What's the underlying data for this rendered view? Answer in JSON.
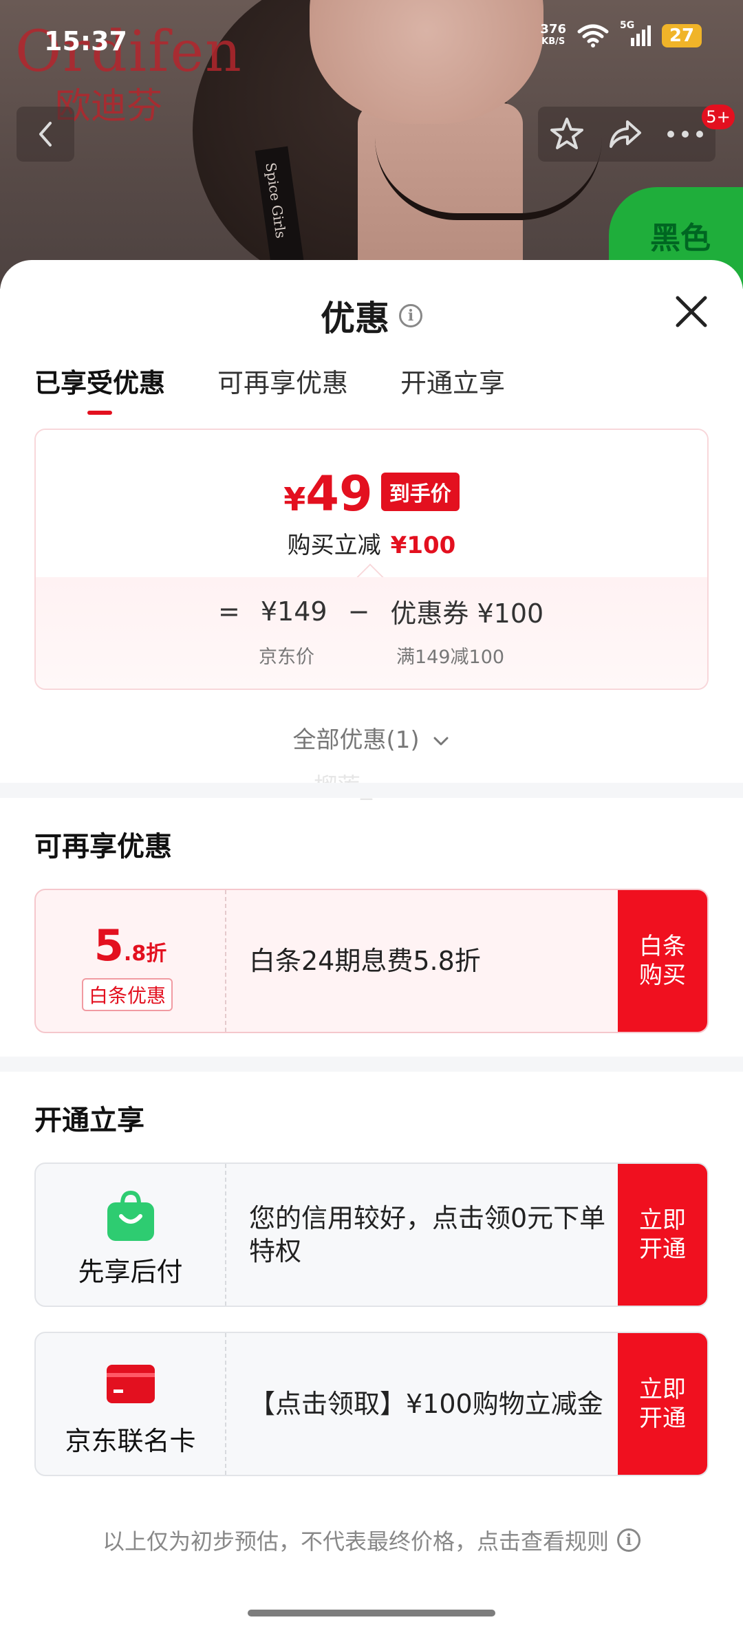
{
  "status_bar": {
    "time": "15:37",
    "net_speed_value": "376",
    "net_speed_unit": "KB/S",
    "network_type": "5G",
    "battery": "27"
  },
  "product_bg": {
    "brand_latin": "Ordifen",
    "brand_cn": "欧迪芬",
    "strap_text": "Spice Girls",
    "promo_text": "黑色",
    "cart_badge": "5+"
  },
  "sheet": {
    "title": "优惠",
    "tabs": [
      {
        "label": "已享受优惠",
        "active": true
      },
      {
        "label": "可再享优惠",
        "active": false
      },
      {
        "label": "开通立享",
        "active": false
      }
    ],
    "price_card": {
      "currency": "¥",
      "final_price": "49",
      "final_tag": "到手价",
      "reduce_label": "购买立减",
      "reduce_amount": "¥100",
      "equals": "=",
      "base_price": "¥149",
      "minus": "−",
      "coupon": "优惠券 ¥100",
      "base_label": "京东价",
      "coupon_rule": "满149减100"
    },
    "all_discounts": "全部优惠(1)",
    "watermark": "榴莲_"
  },
  "more_offers": {
    "title": "可再享优惠",
    "items": [
      {
        "rate_big": "5",
        "rate_small": ".8折",
        "tag": "白条优惠",
        "desc": "白条24期息费5.8折",
        "cta_line1": "白条",
        "cta_line2": "购买"
      }
    ]
  },
  "open_offers": {
    "title": "开通立享",
    "items": [
      {
        "icon": "shopping-bag-icon",
        "label": "先享后付",
        "desc": "您的信用较好，点击领0元下单特权",
        "cta_line1": "立即",
        "cta_line2": "开通"
      },
      {
        "icon": "credit-card-icon",
        "label": "京东联名卡",
        "desc": "【点击领取】¥100购物立减金",
        "cta_line1": "立即",
        "cta_line2": "开通"
      }
    ]
  },
  "footer": {
    "note": "以上仅为初步预估，不代表最终价格，点击查看规则"
  },
  "colors": {
    "accent_red": "#e3101f",
    "cta_red": "#f0101f",
    "green_icon": "#2ecc71"
  }
}
